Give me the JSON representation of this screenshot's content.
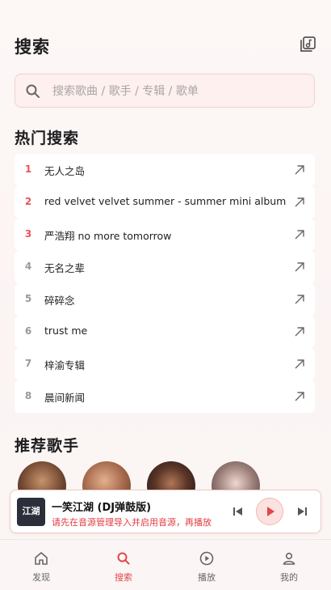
{
  "header": {
    "title": "搜索",
    "library_icon": "music-library-icon"
  },
  "search": {
    "placeholder": "搜索歌曲 / 歌手 / 专辑 / 歌单",
    "value": ""
  },
  "hot": {
    "title": "热门搜索",
    "items": [
      {
        "rank": "1",
        "keyword": "无人之岛"
      },
      {
        "rank": "2",
        "keyword": "red velvet velvet summer - summer mini album"
      },
      {
        "rank": "3",
        "keyword": "严浩翔 no more tomorrow"
      },
      {
        "rank": "4",
        "keyword": "无名之辈"
      },
      {
        "rank": "5",
        "keyword": "碎碎念"
      },
      {
        "rank": "6",
        "keyword": "trust me"
      },
      {
        "rank": "7",
        "keyword": "梓渝专辑"
      },
      {
        "rank": "8",
        "keyword": "晨间新闻"
      }
    ]
  },
  "singers": {
    "title": "推荐歌手"
  },
  "player": {
    "title": "一笑江湖 (DJ弹鼓版)",
    "tip": "请先在音源管理导入并启用音源，再播放",
    "cover_text": "江湖"
  },
  "tabs": [
    {
      "label": "发现",
      "icon": "home-icon"
    },
    {
      "label": "搜索",
      "icon": "search-icon"
    },
    {
      "label": "播放",
      "icon": "play-circle-icon"
    },
    {
      "label": "我的",
      "icon": "user-icon"
    }
  ],
  "colors": {
    "accent": "#e2454a",
    "top_rank": "#e8535a",
    "rank": "#999999"
  }
}
